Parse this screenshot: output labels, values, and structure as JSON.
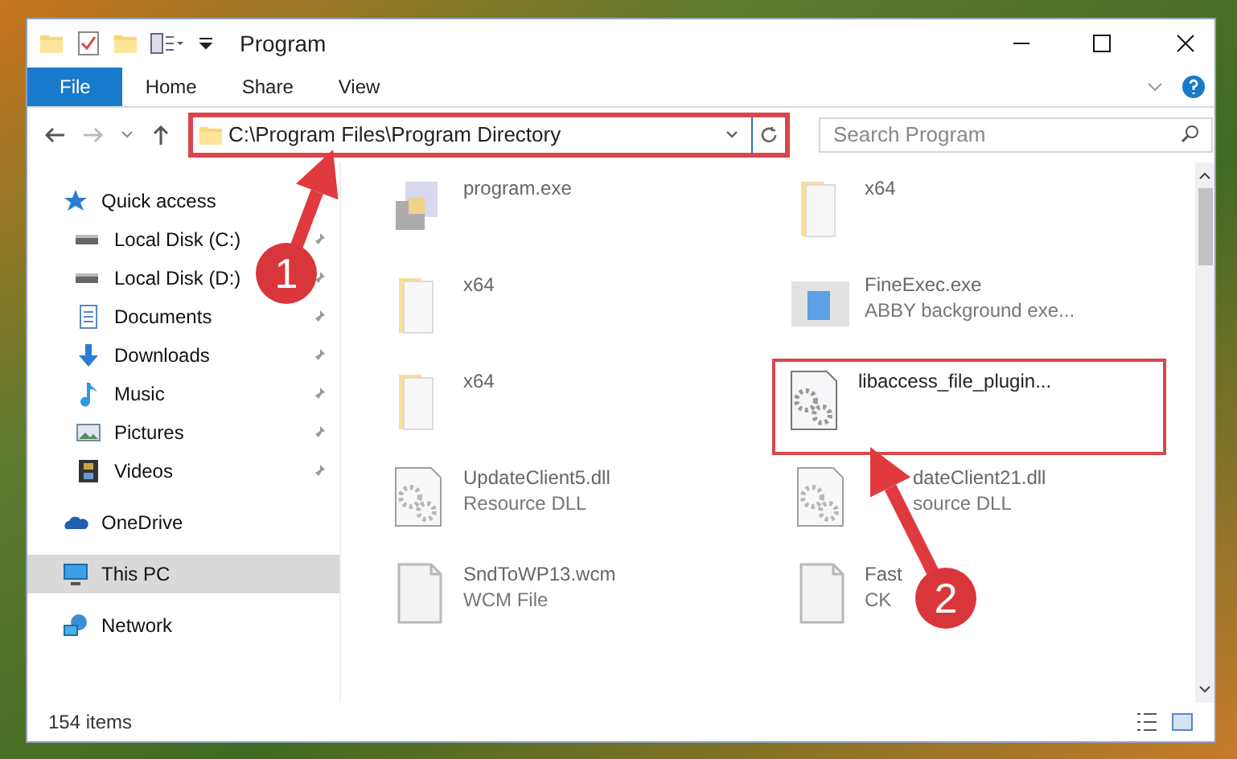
{
  "window": {
    "title": "Program"
  },
  "ribbon_tabs": [
    {
      "label": "File",
      "kind": "file"
    },
    {
      "label": "Home",
      "kind": "tab"
    },
    {
      "label": "Share",
      "kind": "tab"
    },
    {
      "label": "View",
      "kind": "tab"
    }
  ],
  "address": {
    "path": "C:\\Program Files\\Program Directory",
    "highlighted": true
  },
  "search": {
    "placeholder": "Search Program"
  },
  "sidebar": {
    "items": [
      {
        "label": "Quick access",
        "kind": "star",
        "selected": false,
        "children": [
          {
            "label": "Local Disk (C:)",
            "kind": "drive",
            "pinned": true
          },
          {
            "label": "Local Disk (D:)",
            "kind": "drive",
            "pinned": true
          },
          {
            "label": "Documents",
            "kind": "documents",
            "pinned": true
          },
          {
            "label": "Downloads",
            "kind": "downloads",
            "pinned": true
          },
          {
            "label": "Music",
            "kind": "music",
            "pinned": true
          },
          {
            "label": "Pictures",
            "kind": "pictures",
            "pinned": true
          },
          {
            "label": "Videos",
            "kind": "videos",
            "pinned": true
          }
        ]
      },
      {
        "label": "OneDrive",
        "kind": "cloud",
        "selected": false
      },
      {
        "label": "This PC",
        "kind": "pc",
        "selected": true
      },
      {
        "label": "Network",
        "kind": "network",
        "selected": false
      }
    ]
  },
  "files": [
    {
      "name": "program.exe",
      "kind": "exe",
      "blurred": true,
      "highlighted": false,
      "covered": false
    },
    {
      "name": "x64",
      "kind": "folder",
      "blurred": true,
      "highlighted": false,
      "covered": false
    },
    {
      "name": "x64",
      "kind": "folder",
      "blurred": true,
      "highlighted": false,
      "covered": false
    },
    {
      "name": "FineExec.exe",
      "detail": "ABBY background exe...",
      "kind": "app",
      "blurred": true,
      "highlighted": false,
      "covered": false
    },
    {
      "name": "x64",
      "kind": "folder",
      "blurred": true,
      "highlighted": false,
      "covered": false
    },
    {
      "name": "libaccess_file_plugin...",
      "kind": "gear",
      "blurred": false,
      "highlighted": true,
      "covered": false
    },
    {
      "name": "UpdateClient5.dll",
      "detail": "Resource DLL",
      "kind": "gear",
      "blurred": true,
      "highlighted": false,
      "covered": false
    },
    {
      "name": "dateClient21.dll",
      "detail": "source DLL",
      "kind": "gear",
      "blurred": true,
      "highlighted": false,
      "covered": true
    },
    {
      "name": "SndToWP13.wcm",
      "detail": "WCM File",
      "kind": "blank",
      "blurred": true,
      "highlighted": false,
      "covered": false
    },
    {
      "name": "Fast",
      "detail": "CK",
      "kind": "blank",
      "blurred": true,
      "highlighted": false,
      "covered": false
    }
  ],
  "status_bar": {
    "count": "154 items"
  },
  "callouts": [
    {
      "number": "1"
    },
    {
      "number": "2"
    }
  ]
}
